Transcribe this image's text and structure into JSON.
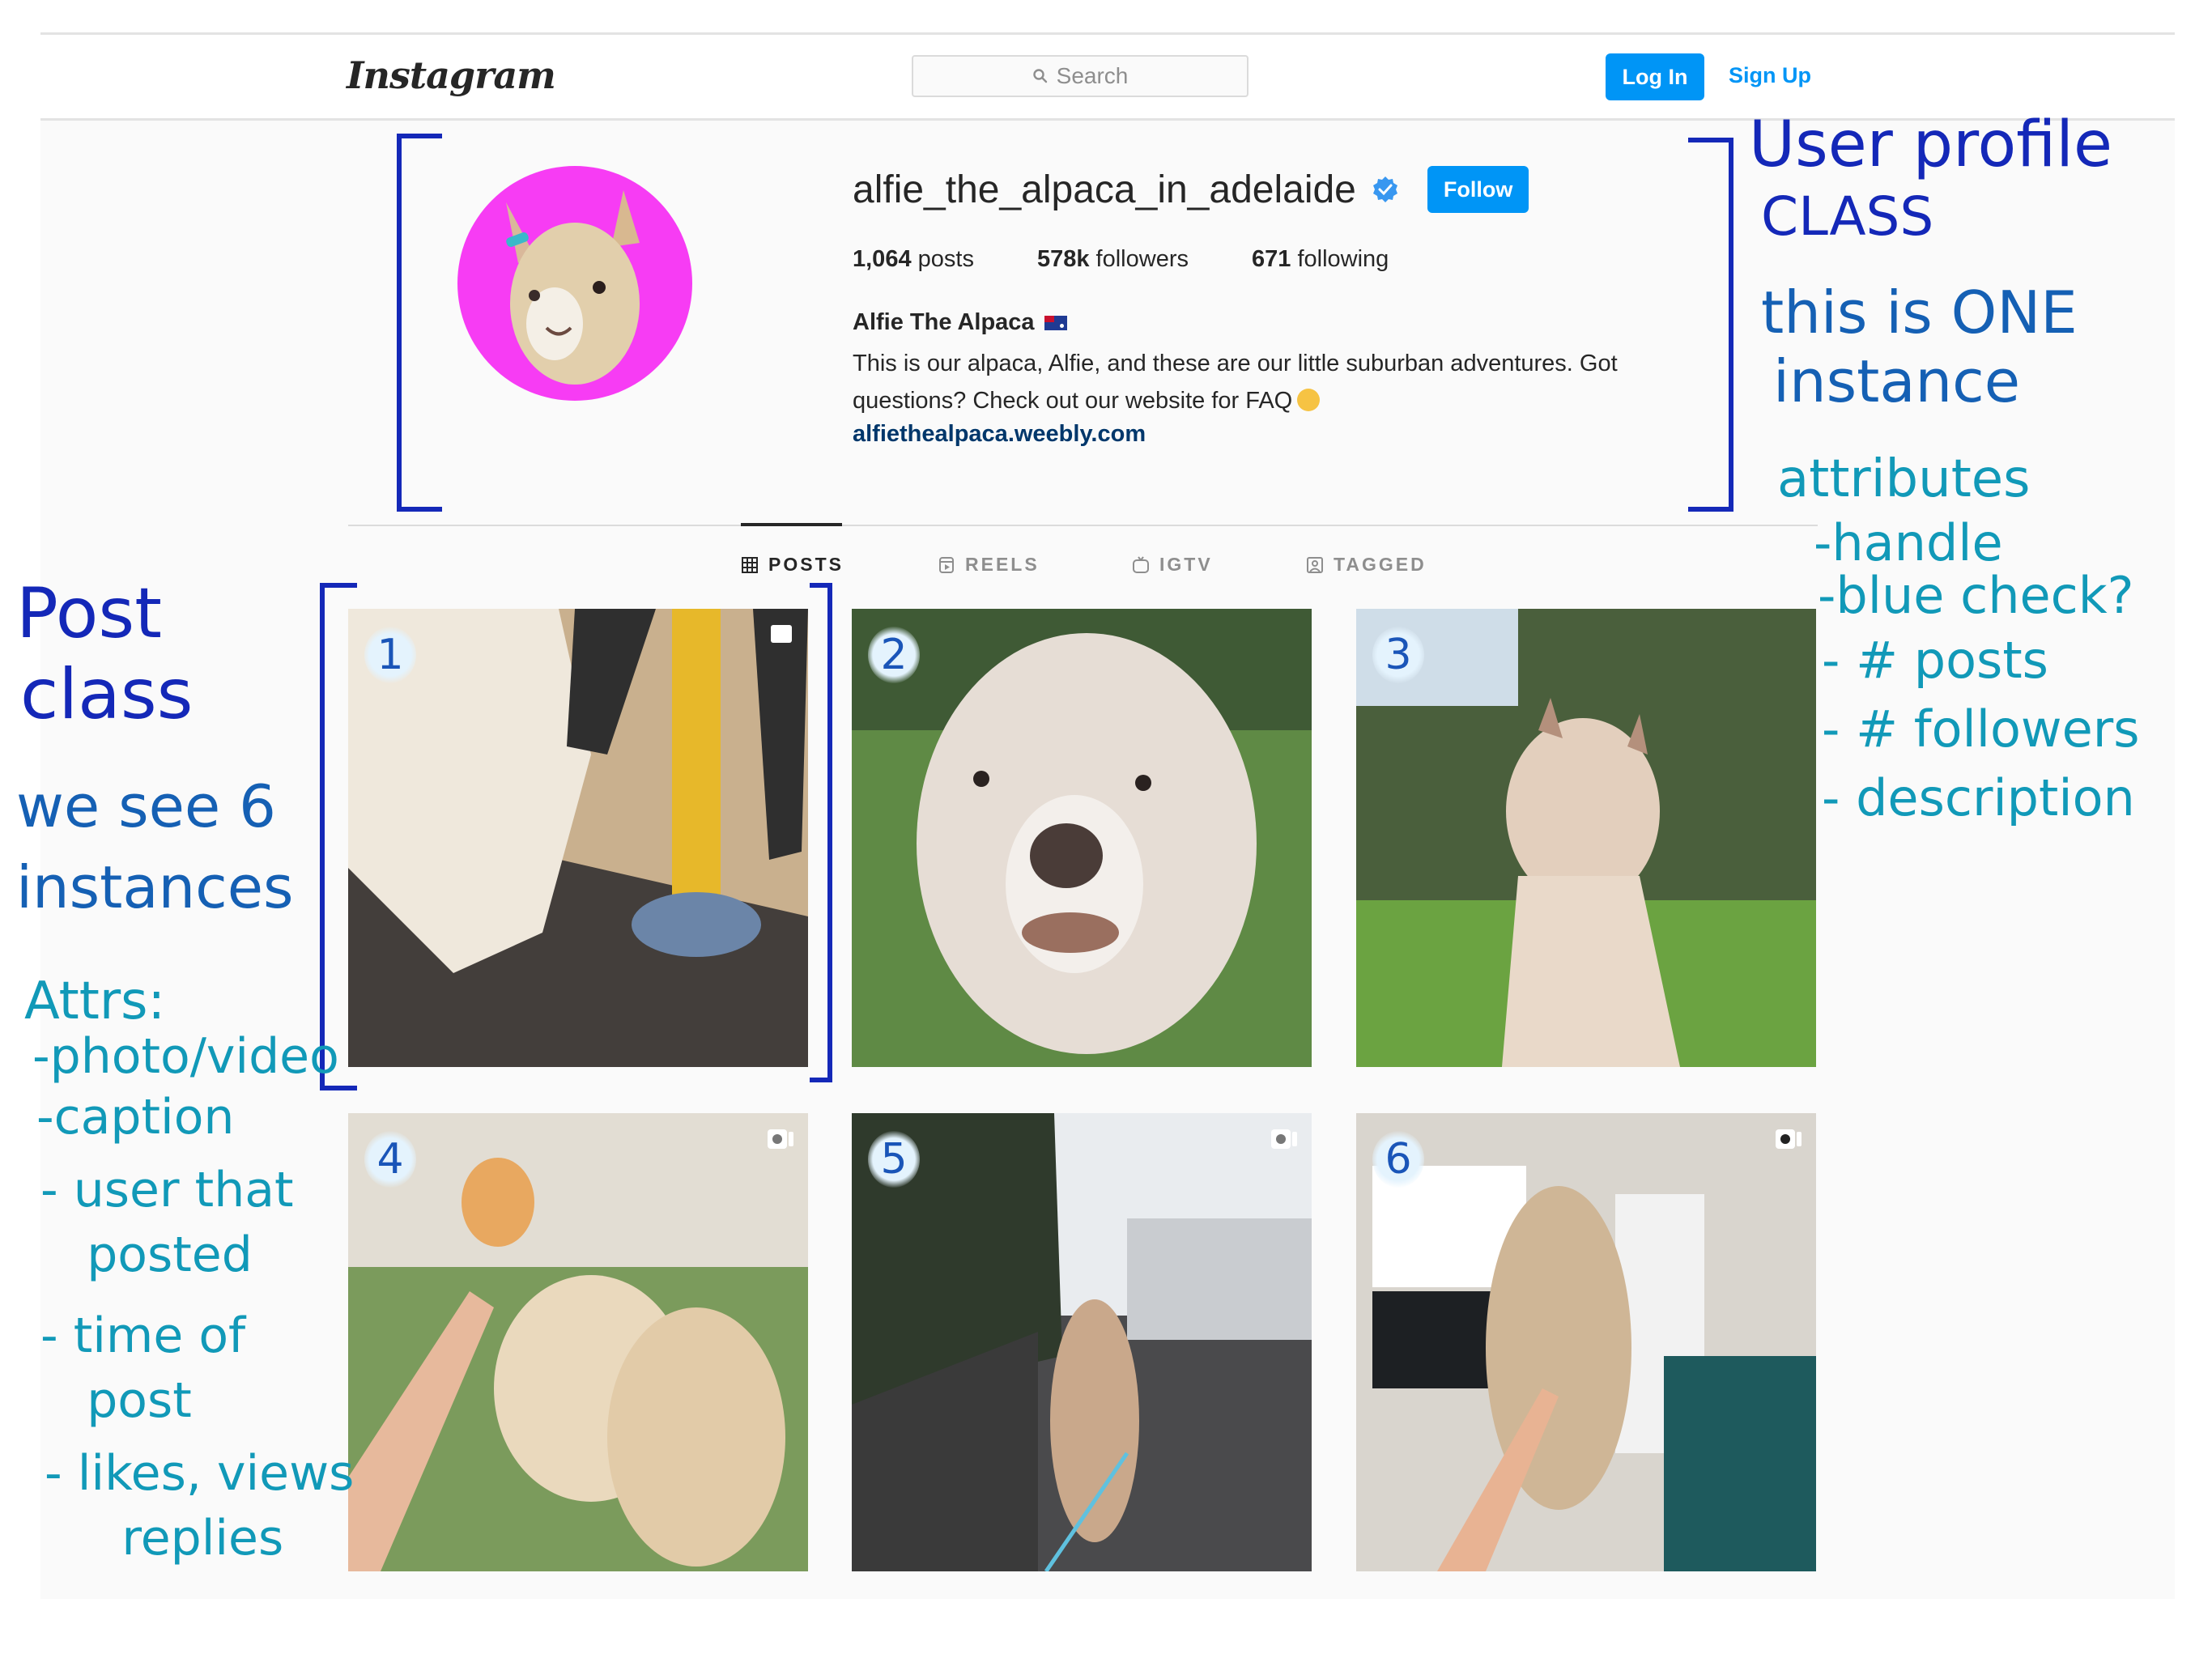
{
  "app": {
    "logo": "Instagram",
    "search": {
      "placeholder": "Search",
      "icon": "search-icon"
    },
    "login_label": "Log In",
    "signup_label": "Sign Up",
    "accent_color": "#0095f6"
  },
  "profile": {
    "handle": "alfie_the_alpaca_in_adelaide",
    "verified": true,
    "follow_label": "Follow",
    "stats": [
      {
        "value": "1,064",
        "label": "posts"
      },
      {
        "value": "578k",
        "label": "followers"
      },
      {
        "value": "671",
        "label": "following"
      }
    ],
    "full_name": "Alfie The Alpaca",
    "name_emoji": "australian-flag",
    "bio_line1": "This is our alpaca, Alfie, and these are our little suburban adventures. Got",
    "bio_line2": "questions? Check out our website for FAQ",
    "bio_emoji": "smiling-face",
    "website": "alfiethealpaca.weebly.com",
    "avatar_bg": "#f73cf4"
  },
  "tabs": [
    {
      "label": "POSTS",
      "icon": "grid-icon",
      "active": true
    },
    {
      "label": "REELS",
      "icon": "reels-icon",
      "active": false
    },
    {
      "label": "IGTV",
      "icon": "igtv-icon",
      "active": false
    },
    {
      "label": "TAGGED",
      "icon": "tagged-icon",
      "active": false
    }
  ],
  "posts": [
    {
      "number": "1",
      "subject": "alpaca leg and person's hand near yellow pole",
      "media_icon": "multi-photo-icon"
    },
    {
      "number": "2",
      "subject": "close-up of fluffy alpaca face on grass",
      "media_icon": null
    },
    {
      "number": "3",
      "subject": "alpaca standing in park under trees",
      "media_icon": null
    },
    {
      "number": "4",
      "subject": "hand reaching to alpaca on lawn",
      "media_icon": "video-icon"
    },
    {
      "number": "5",
      "subject": "alpaca on leash walking on suburban street",
      "media_icon": "video-icon"
    },
    {
      "number": "6",
      "subject": "alpaca eating treat in living room",
      "media_icon": "video-icon"
    }
  ],
  "annotations": {
    "user_profile": {
      "title_line1": "User profile",
      "title_line2": "CLASS",
      "note_line1": "this is ONE",
      "note_line2": "instance",
      "attributes_title": "attributes",
      "attributes": [
        "-handle",
        "-blue check?",
        "- # posts",
        "- # followers",
        "- description"
      ]
    },
    "post": {
      "title_line1": "Post",
      "title_line2": "class",
      "note_line1": "we see 6",
      "note_line2": "instances",
      "attrs_title": "Attrs:",
      "attrs": [
        "-photo/video",
        "-caption",
        "- user that",
        "   posted",
        "- time of",
        "   post",
        "- likes, views",
        "     replies"
      ]
    }
  }
}
